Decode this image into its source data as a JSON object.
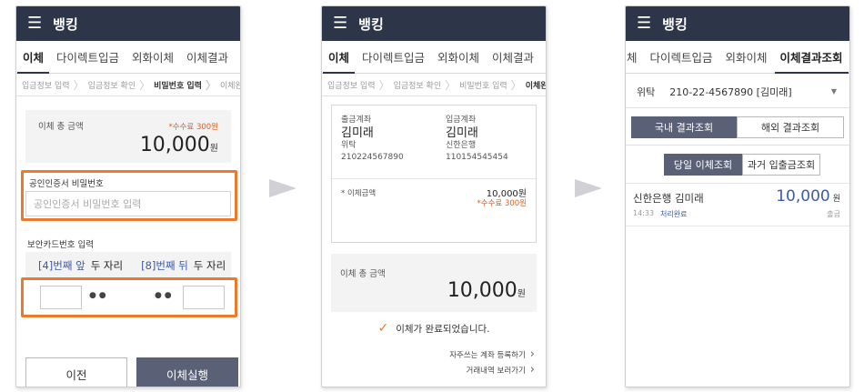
{
  "app_title": "뱅킹",
  "screen1": {
    "tabs": [
      "이체",
      "다이렉트입금",
      "외화이체",
      "이체결과"
    ],
    "steps": [
      "입금정보 입력",
      "입금정보 확인",
      "비밀번호 입력",
      "이체완료"
    ],
    "total_label": "이체 총 금액",
    "fee": "*수수료 300원",
    "amount": "10,000",
    "won": "원",
    "cert_label": "공인인증서 비밀번호",
    "cert_placeholder": "공인인증서 비밀번호 입력",
    "card_label": "보안카드번호 입력",
    "card_front_hint": "[4]번째 앞",
    "card_front_digits": "두 자리",
    "card_back_hint": "[8]번째 뒤",
    "card_back_digits": "두 자리",
    "dots": "● ●",
    "prev_button": "이전",
    "execute_button": "이체실행"
  },
  "screen2": {
    "tabs": [
      "이체",
      "다이렉트입금",
      "외화이체",
      "이체결과"
    ],
    "steps": [
      "입금정보 입력",
      "입금정보 확인",
      "비밀번호 입력",
      "이체완료"
    ],
    "from_label": "출금계좌",
    "from_name": "김미래",
    "from_bank": "위탁",
    "from_account": "210224567890",
    "to_label": "입금계좌",
    "to_name": "김미래",
    "to_bank": "신한은행",
    "to_account": "110154545454",
    "transfer_amount_label": "* 이체금액",
    "transfer_amount": "10,000원",
    "fee": "*수수료 300원",
    "total_label": "이체 총 금액",
    "total_amount": "10,000",
    "won": "원",
    "check_mark": "✓",
    "complete_message": "이체가 완료되었습니다.",
    "register_link": "자주쓰는 계좌 등록하기",
    "history_link": "거래내역 보러가기",
    "chevron": "›"
  },
  "screen3": {
    "tabs": [
      "체",
      "다이렉트입금",
      "외화이체",
      "이체결과조회"
    ],
    "account_type": "위탁",
    "account_number": "210-22-4567890 [김미래]",
    "dropdown_arrow": "▼",
    "seg1": [
      "국내 결과조회",
      "해외 결과조회"
    ],
    "seg2": [
      "당일 이체조회",
      "과거 입출금조회"
    ],
    "result_name": "신한은행 김미래",
    "result_amount": "10,000",
    "won": "원",
    "result_time": "14:33",
    "result_status": "처리완료",
    "result_type": "출금"
  },
  "colors": {
    "appbar": "#2d3548",
    "highlight": "#ec7a2c",
    "accent_blue": "#3c5aa8",
    "check": "#ec7a2c"
  }
}
